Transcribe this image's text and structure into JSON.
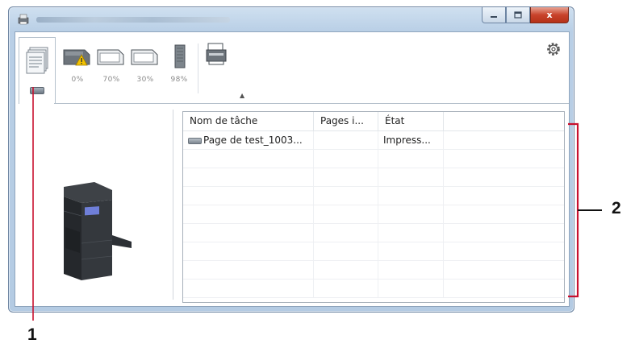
{
  "window": {
    "title": "",
    "buttons": {
      "minimize": "−",
      "maximize": "□",
      "close": "x"
    }
  },
  "toolbar": {
    "toner": [
      {
        "name": "toner-k",
        "level": "0%"
      },
      {
        "name": "toner-c",
        "level": "70%"
      },
      {
        "name": "toner-m",
        "level": "30%"
      },
      {
        "name": "toner-y",
        "level": "98%"
      }
    ],
    "collapse_glyph": "▲",
    "settings_icon": "gear-icon"
  },
  "job_list": {
    "columns": [
      "Nom de tâche",
      "Pages i...",
      "État"
    ],
    "rows": [
      {
        "name": "Page de test_1003...",
        "pages": "",
        "state": "Impress..."
      }
    ]
  },
  "annotations": {
    "callout_1": "1",
    "callout_2": "2"
  },
  "colors": {
    "frame": "#b9cfe6",
    "close_button": "#c8432b",
    "warning": "#f2c200"
  }
}
